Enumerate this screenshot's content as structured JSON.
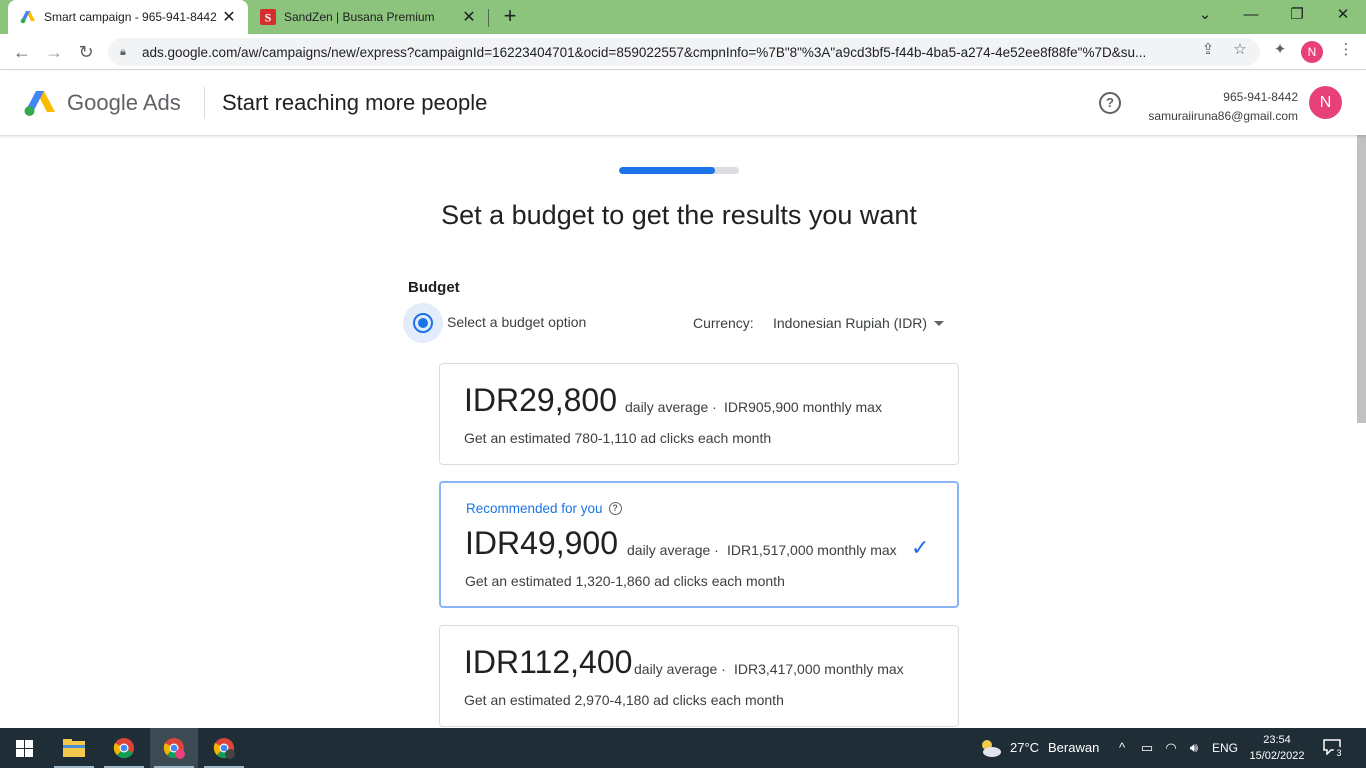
{
  "browser": {
    "tabs": [
      {
        "title": "Smart campaign - 965-941-8442",
        "active": true
      },
      {
        "title": "SandZen | Busana Premium",
        "active": false
      }
    ],
    "url": "ads.google.com/aw/campaigns/new/express?campaignId=16223404701&ocid=859022557&cmpnInfo=%7B\"8\"%3A\"a9cd3bf5-f44b-4ba5-a274-4e52ee8f88fe\"%7D&su...",
    "profile_initial": "N"
  },
  "header": {
    "product_name": "Google Ads",
    "page_title": "Start reaching more people",
    "account_id": "965-941-8442",
    "account_email": "samuraiiruna86@gmail.com",
    "avatar_initial": "N"
  },
  "progress": {
    "fraction": 0.8
  },
  "main": {
    "heading": "Set a budget to get the results you want",
    "budget_label": "Budget",
    "option_label": "Select a budget option",
    "currency_label": "Currency:",
    "currency_value": "Indonesian Rupiah (IDR)"
  },
  "budget_options": [
    {
      "amount": "IDR29,800",
      "daily": "daily average ·",
      "monthly": "IDR905,900 monthly max",
      "estimate": "Get an estimated 780-1,110 ad clicks each month"
    },
    {
      "recommended": "Recommended for you",
      "amount": "IDR49,900",
      "daily": "daily average ·",
      "monthly": "IDR1,517,000 monthly max",
      "estimate": "Get an estimated 1,320-1,860 ad clicks each month",
      "selected": true
    },
    {
      "amount": "IDR112,400",
      "daily": "daily average ·",
      "monthly": "IDR3,417,000 monthly max",
      "estimate": "Get an estimated 2,970-4,180 ad clicks each month"
    }
  ],
  "taskbar": {
    "weather_temp": "27°C",
    "weather_desc": "Berawan",
    "language": "ENG",
    "time": "23:54",
    "date": "15/02/2022",
    "notification_count": "3"
  },
  "colors": {
    "accent": "#1a73e8",
    "tabstrip": "#8dc47d",
    "avatar": "#e8407a",
    "taskbar": "#1f2d36"
  }
}
